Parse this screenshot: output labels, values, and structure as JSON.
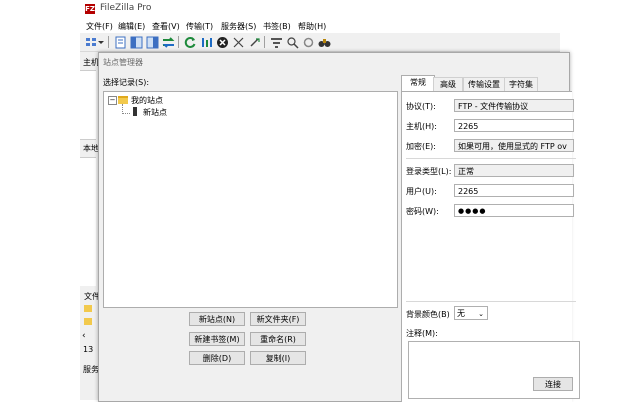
{
  "app": {
    "title": "FileZilla Pro",
    "icon_text": "FZ"
  },
  "menu": [
    {
      "label": "文件(F)"
    },
    {
      "label": "编辑(E)"
    },
    {
      "label": "查看(V)"
    },
    {
      "label": "传输(T)"
    },
    {
      "label": "服务器(S)"
    },
    {
      "label": "书签(B)"
    },
    {
      "label": "帮助(H)"
    }
  ],
  "background": {
    "host_label": "主机",
    "local_label": "本地",
    "file_label": "文件",
    "count": "13",
    "server_label": "服务"
  },
  "dialog": {
    "title": "站点管理器",
    "select_label": "选择记录(S):",
    "tree": {
      "root": "我的站点",
      "child": "新站点"
    },
    "buttons": {
      "new_site": "新站点(N)",
      "new_folder": "新文件夹(F)",
      "new_bookmark": "新建书签(M)",
      "rename": "重命名(R)",
      "delete": "删除(D)",
      "copy": "复制(I)",
      "connect": "连接"
    },
    "tabs": [
      "常规",
      "高级",
      "传输设置",
      "字符集"
    ],
    "general": {
      "protocol_label": "协议(T):",
      "protocol_value": "FTP - 文件传输协议",
      "host_label": "主机(H):",
      "host_value": "2265",
      "encryption_label": "加密(E):",
      "encryption_value": "如果可用，使用显式的 FTP ov",
      "logon_label": "登录类型(L):",
      "logon_value": "正常",
      "user_label": "用户(U):",
      "user_value": "2265",
      "password_label": "密码(W):",
      "password_value": "●●●●",
      "bgcolor_label": "背景颜色(B)",
      "bgcolor_value": "无",
      "notes_label": "注释(M):"
    }
  }
}
